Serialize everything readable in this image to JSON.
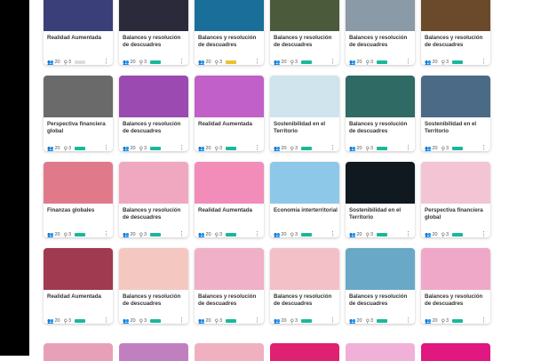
{
  "cards": [
    {
      "title": "Realidad Aumentada",
      "users": "20",
      "groups": "3",
      "badge_color": "#dddddd",
      "thumb": "#3a3f7a"
    },
    {
      "title": "Balances y resolución de descuadres",
      "users": "20",
      "groups": "3",
      "badge_color": "#19b89a",
      "thumb": "#2a2a3a"
    },
    {
      "title": "Balances y resolución de descuadres",
      "users": "20",
      "groups": "3",
      "badge_color": "#e8c230",
      "thumb": "#1a6f9a"
    },
    {
      "title": "Balances y resolución de descuadres",
      "users": "20",
      "groups": "3",
      "badge_color": "#19b89a",
      "thumb": "#4a5a3a"
    },
    {
      "title": "Balances y resolución de descuadres",
      "users": "20",
      "groups": "3",
      "badge_color": "#19b89a",
      "thumb": "#8a9aa6"
    },
    {
      "title": "Balances y resolución de descuadres",
      "users": "20",
      "groups": "3",
      "badge_color": "#19b89a",
      "thumb": "#6a4a2a"
    },
    {
      "title": "Perspectiva financiera global",
      "users": "20",
      "groups": "3",
      "badge_color": "#19b89a",
      "thumb": "#6a6a6a"
    },
    {
      "title": "Balances y resolución de descuadres",
      "users": "20",
      "groups": "3",
      "badge_color": "#19b89a",
      "thumb": "#9a4ab0"
    },
    {
      "title": "Realidad Aumentada",
      "users": "20",
      "groups": "3",
      "badge_color": "#19b89a",
      "thumb": "#c060c8"
    },
    {
      "title": "Sostenibilidad en el Territorio",
      "users": "20",
      "groups": "3",
      "badge_color": "#19b89a",
      "thumb": "#cfe4ec"
    },
    {
      "title": "Balances y resolución de descuadres",
      "users": "20",
      "groups": "3",
      "badge_color": "#19b89a",
      "thumb": "#2f6a64"
    },
    {
      "title": "Sostenibilidad en el Territorio",
      "users": "20",
      "groups": "3",
      "badge_color": "#19b89a",
      "thumb": "#4a6a86"
    },
    {
      "title": "Finanzas globales",
      "users": "20",
      "groups": "3",
      "badge_color": "#19b89a",
      "thumb": "#e07a8a"
    },
    {
      "title": "Balances y resolución de descuadres",
      "users": "20",
      "groups": "3",
      "badge_color": "#19b89a",
      "thumb": "#f0a8c0"
    },
    {
      "title": "Realidad Aumentada",
      "users": "20",
      "groups": "3",
      "badge_color": "#19b89a",
      "thumb": "#f28cb8"
    },
    {
      "title": "Economía interterritorial",
      "users": "20",
      "groups": "3",
      "badge_color": "#19b89a",
      "thumb": "#8ec8e8"
    },
    {
      "title": "Sostenibilidad en el Territorio",
      "users": "20",
      "groups": "3",
      "badge_color": "#19b89a",
      "thumb": "#101820"
    },
    {
      "title": "Perspectiva financiera global",
      "users": "20",
      "groups": "3",
      "badge_color": "#19b89a",
      "thumb": "#f2c4d4"
    },
    {
      "title": "Realidad Aumentada",
      "users": "20",
      "groups": "3",
      "badge_color": "#19b89a",
      "thumb": "#a03a50"
    },
    {
      "title": "Balances y resolución de descuadres",
      "users": "20",
      "groups": "3",
      "badge_color": "#19b89a",
      "thumb": "#f4c8c0"
    },
    {
      "title": "Balances y resolución de descuadres",
      "users": "20",
      "groups": "3",
      "badge_color": "#19b89a",
      "thumb": "#f0b0c8"
    },
    {
      "title": "Balances y resolución de descuadres",
      "users": "20",
      "groups": "3",
      "badge_color": "#19b89a",
      "thumb": "#f3c0c8"
    },
    {
      "title": "Balances y resolución de descuadres",
      "users": "20",
      "groups": "3",
      "badge_color": "#19b89a",
      "thumb": "#6aa8c8"
    },
    {
      "title": "Balances y resolución de descuadres",
      "users": "20",
      "groups": "3",
      "badge_color": "#19b89a",
      "thumb": "#f0a8c8"
    }
  ],
  "partial_row": [
    "#e8a0b8",
    "#c080c0",
    "#f0b0c0",
    "#e02070",
    "#f0b0d8",
    "#e01880"
  ],
  "icons": {
    "users": "users-icon",
    "groups": "groups-icon",
    "more": "more-vertical-icon"
  }
}
